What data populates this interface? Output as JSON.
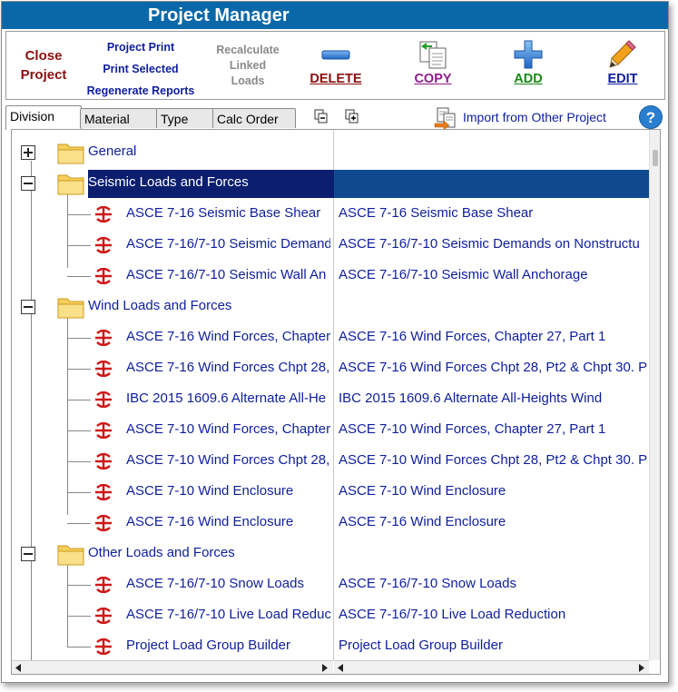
{
  "window": {
    "title": "Project Manager"
  },
  "toolbar": {
    "close_project": [
      "Close",
      "Project"
    ],
    "project_print": "Project Print",
    "print_selected": "Print Selected",
    "regenerate_reports": "Regenerate Reports",
    "recalculate": [
      "Recalculate",
      "Linked",
      "Loads"
    ],
    "delete": {
      "label": "DELETE",
      "color": "#8b1010",
      "icon": "minus-icon"
    },
    "copy": {
      "label": "COPY",
      "color": "#8a1a8a",
      "icon": "copy-icon"
    },
    "add": {
      "label": "ADD",
      "color": "#1a8a1a",
      "icon": "plus-icon"
    },
    "edit": {
      "label": "EDIT",
      "color": "#0e1e9c",
      "icon": "pencil-icon"
    }
  },
  "tabs": [
    {
      "label": "Division",
      "active": true
    },
    {
      "label": "Material"
    },
    {
      "label": "Type"
    },
    {
      "label": "Calc Order"
    }
  ],
  "import_label": "Import from Other Project",
  "help_label": "?",
  "tree": [
    {
      "kind": "group",
      "expanded": false,
      "name": "General",
      "desc": ""
    },
    {
      "kind": "group",
      "expanded": true,
      "selected": true,
      "name": "Seismic Loads and Forces",
      "desc": ""
    },
    {
      "kind": "item",
      "name": "ASCE 7-16 Seismic Base Shear",
      "desc": "ASCE 7-16 Seismic Base Shear"
    },
    {
      "kind": "item",
      "name": "ASCE 7-16/7-10 Seismic Demand",
      "desc": "ASCE 7-16/7-10 Seismic Demands on Nonstructu"
    },
    {
      "kind": "item",
      "name": "ASCE 7-16/7-10 Seismic Wall An",
      "desc": "ASCE 7-16/7-10 Seismic Wall Anchorage"
    },
    {
      "kind": "group",
      "expanded": true,
      "name": "Wind Loads and Forces",
      "desc": ""
    },
    {
      "kind": "item",
      "name": "ASCE 7-16 Wind Forces, Chapter",
      "desc": "ASCE 7-16 Wind Forces, Chapter 27, Part 1"
    },
    {
      "kind": "item",
      "name": "ASCE 7-16 Wind Forces Chpt 28,",
      "desc": "ASCE 7-16 Wind Forces Chpt 28, Pt2 & Chpt 30. P"
    },
    {
      "kind": "item",
      "name": "IBC 2015 1609.6 Alternate All-He",
      "desc": "IBC 2015 1609.6 Alternate All-Heights Wind"
    },
    {
      "kind": "item",
      "name": "ASCE 7-10 Wind Forces, Chapter",
      "desc": "ASCE 7-10 Wind Forces, Chapter 27, Part 1"
    },
    {
      "kind": "item",
      "name": "ASCE 7-10 Wind Forces Chpt 28,",
      "desc": "ASCE 7-10 Wind Forces Chpt 28, Pt2 & Chpt 30. P"
    },
    {
      "kind": "item",
      "name": "ASCE 7-10 Wind Enclosure",
      "desc": "ASCE 7-10 Wind Enclosure"
    },
    {
      "kind": "item",
      "name": "ASCE 7-16 Wind Enclosure",
      "desc": "ASCE 7-16 Wind Enclosure"
    },
    {
      "kind": "group",
      "expanded": true,
      "name": "Other Loads and Forces",
      "desc": ""
    },
    {
      "kind": "item",
      "name": "ASCE 7-16/7-10 Snow Loads",
      "desc": "ASCE 7-16/7-10 Snow Loads"
    },
    {
      "kind": "item",
      "name": "ASCE 7-16/7-10 Live Load Reduc",
      "desc": "ASCE 7-16/7-10 Live Load Reduction"
    },
    {
      "kind": "item",
      "name": "Project Load Group Builder",
      "desc": "Project Load Group Builder"
    }
  ]
}
